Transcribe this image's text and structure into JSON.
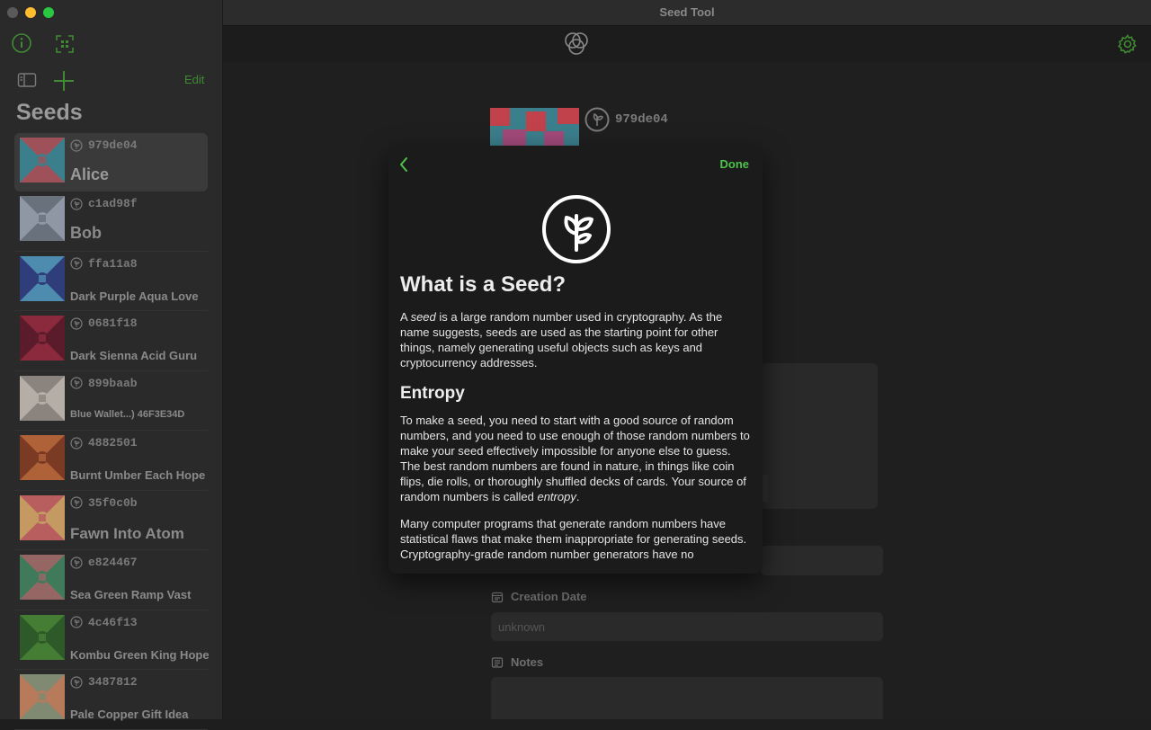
{
  "window": {
    "title": "Seed Tool"
  },
  "sidebar": {
    "heading": "Seeds",
    "edit_label": "Edit",
    "seeds": [
      {
        "id": "979de04",
        "name": "Alice",
        "colors": [
          "#3b7f8c",
          "#c1424a"
        ]
      },
      {
        "id": "c1ad98f",
        "name": "Bob",
        "colors": [
          "#8e97a3",
          "#5c6470"
        ]
      },
      {
        "id": "ffa11a8",
        "name": "Dark Purple Aqua Love",
        "colors": [
          "#2f3e7a",
          "#5aa7c1"
        ]
      },
      {
        "id": "0681f18",
        "name": "Dark Sienna Acid Guru",
        "colors": [
          "#5a1c2a",
          "#9c2f44"
        ]
      },
      {
        "id": "899baab",
        "name": "Blue Wallet...) 46F3E34D",
        "colors": [
          "#b5aea6",
          "#7d7670"
        ]
      },
      {
        "id": "4882501",
        "name": "Burnt Umber Each Hope",
        "colors": [
          "#7a3a24",
          "#c2703e"
        ]
      },
      {
        "id": "35f0c0b",
        "name": "Fawn Into Atom",
        "colors": [
          "#c49a62",
          "#b54a5e"
        ]
      },
      {
        "id": "e824467",
        "name": "Sea Green Ramp Vast",
        "colors": [
          "#3f7a5a",
          "#b4606a"
        ]
      },
      {
        "id": "4c46f13",
        "name": "Kombu Green King Hope",
        "colors": [
          "#2e5a2a",
          "#4f8a3a"
        ]
      },
      {
        "id": "3487812",
        "name": "Pale Copper Gift Idea",
        "colors": [
          "#b77a5a",
          "#6d8f7a"
        ]
      }
    ]
  },
  "detail": {
    "seed_id": "979de04",
    "creation_date_label": "Creation Date",
    "creation_date_value": "unknown",
    "notes_label": "Notes"
  },
  "modal": {
    "done_label": "Done",
    "title": "What is a Seed?",
    "intro_1": "A ",
    "intro_em": "seed",
    "intro_2": " is a large random number used in cryptography. As the name suggests, seeds are used as the starting point for other things, namely generating useful objects such as keys and cryptocurrency addresses.",
    "entropy_heading": "Entropy",
    "entropy_1": "To make a seed, you need to start with a good source of random numbers, and you need to use enough of those random numbers to make your seed effectively impossible for anyone else to guess. The best random numbers are found in nature, in things like coin flips, die rolls, or thoroughly shuffled decks of cards. Your source of random numbers is called ",
    "entropy_em": "entropy",
    "entropy_2": ".",
    "para_3": "Many computer programs that generate random numbers have statistical flaws that make them inappropriate for generating seeds. Cryptography-grade random number generators have no"
  },
  "colors": {
    "accent": "#4ec24a",
    "accent_dim": "#3f8a33",
    "background": "#1e1e1e",
    "sidebar": "#2a2a2a"
  }
}
